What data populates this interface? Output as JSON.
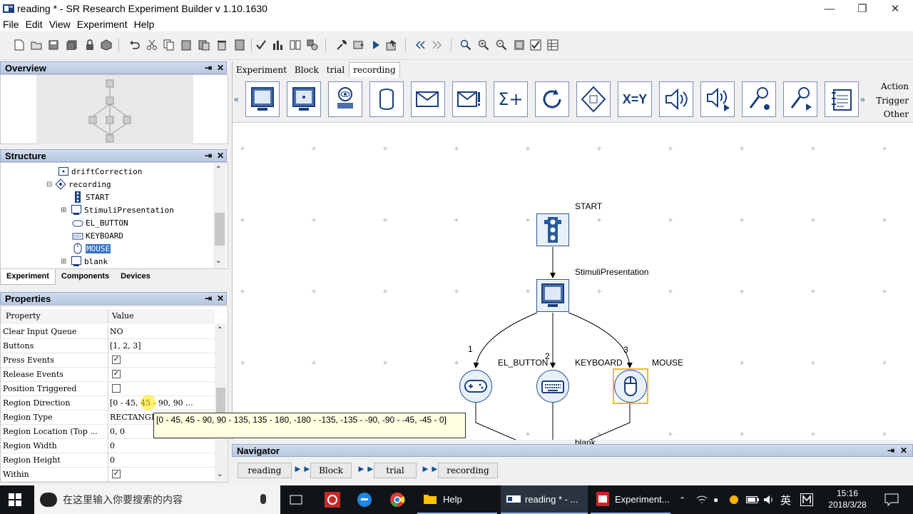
{
  "window": {
    "title": "reading * - SR Research Experiment Builder v 1.10.1630"
  },
  "menu": [
    "File",
    "Edit",
    "View",
    "Experiment",
    "Help"
  ],
  "panels": {
    "overview": "Overview",
    "structure": "Structure",
    "properties": "Properties",
    "navigator": "Navigator"
  },
  "structure_tree": [
    {
      "label": "driftCorrection",
      "icon": "drift-correction-icon"
    },
    {
      "label": "recording",
      "icon": "sequence-icon"
    },
    {
      "label": "START",
      "icon": "start-traffic-light-icon"
    },
    {
      "label": "StimuliPresentation",
      "icon": "display-screen-icon"
    },
    {
      "label": "EL_BUTTON",
      "icon": "gamepad-icon"
    },
    {
      "label": "KEYBOARD",
      "icon": "keyboard-icon"
    },
    {
      "label": "MOUSE",
      "icon": "mouse-icon",
      "selected": true
    },
    {
      "label": "blank",
      "icon": "display-screen-icon"
    }
  ],
  "structure_tabs": [
    "Experiment",
    "Components",
    "Devices"
  ],
  "properties_header": {
    "property": "Property",
    "value": "Value"
  },
  "properties": [
    {
      "name": "Clear Input Queue",
      "value": "NO"
    },
    {
      "name": "Buttons",
      "value": "[1, 2, 3]"
    },
    {
      "name": "Press Events",
      "checkbox": true
    },
    {
      "name": "Release Events",
      "checkbox": true
    },
    {
      "name": "Position Triggered",
      "checkbox": false
    },
    {
      "name": "Region Direction",
      "value": "[0 - 45, 45 - 90, 90 ..."
    },
    {
      "name": "Region Type",
      "value": "RECTANGLE"
    },
    {
      "name": "Region Location (Top ...",
      "value": "0, 0"
    },
    {
      "name": "Region Width",
      "value": "0"
    },
    {
      "name": "Region Height",
      "value": "0"
    },
    {
      "name": "Within",
      "checkbox": true
    }
  ],
  "tooltip": {
    "text": "[0 - 45, 45 - 90, 90 - 135, 135 - 180, -180 - -135, -135 - -90, -90 - -45, -45 - 0]"
  },
  "doc_tabs": [
    "Experiment",
    "Block",
    "trial",
    "recording"
  ],
  "palette_categories": [
    "Action",
    "Trigger",
    "Other"
  ],
  "palette_items": [
    "display-screen-icon",
    "drift-correct-screen-icon",
    "eye-camera-setup-icon",
    "database-icon",
    "send-message-icon",
    "error-message-icon",
    "sum-variable-icon",
    "loop-refresh-icon",
    "sequence-diamond-icon",
    "x-equals-y-icon",
    "speaker-play-icon",
    "speaker-record-icon",
    "microphone-record-icon",
    "microphone-play-icon",
    "notebook-log-icon"
  ],
  "palette_text": {
    "xy": "X=Y",
    "sum": "Σ+"
  },
  "flow": {
    "nodes": [
      {
        "id": "start",
        "label": "START"
      },
      {
        "id": "stim",
        "label": "StimuliPresentation"
      },
      {
        "id": "elbtn",
        "label": "EL_BUTTON"
      },
      {
        "id": "kbd",
        "label": "KEYBOARD"
      },
      {
        "id": "mouse",
        "label": "MOUSE"
      },
      {
        "id": "blank",
        "label": "blank"
      }
    ],
    "edge_labels": [
      "1",
      "2",
      "3"
    ]
  },
  "navigator_path": [
    "reading",
    "Block",
    "trial",
    "recording"
  ],
  "taskbar": {
    "search_placeholder": "在这里输入你要搜索的内容",
    "apps": [
      "Help",
      "reading * - ...",
      "Experiment..."
    ],
    "ime": "英",
    "time": "15:16",
    "date": "2018/3/28"
  },
  "colors": {
    "accent": "#1a4f8f",
    "selection": "#3470c8",
    "tooltip": "#ffffe1",
    "mouse_highlight": "#f0c000"
  }
}
